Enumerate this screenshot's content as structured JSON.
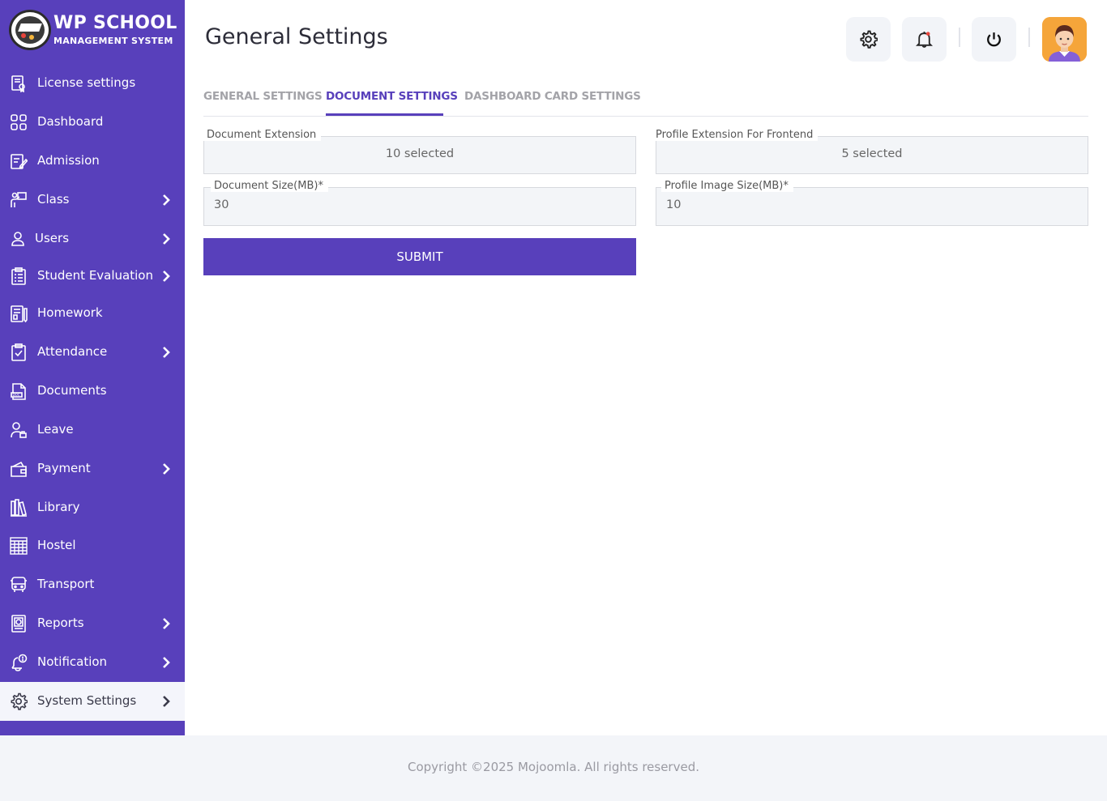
{
  "brand": {
    "title": "WP SCHOOL",
    "subtitle": "MANAGEMENT SYSTEM"
  },
  "sidebar": {
    "items": [
      {
        "label": "License settings",
        "icon": "license-icon",
        "has_submenu": false
      },
      {
        "label": "Dashboard",
        "icon": "dashboard-icon",
        "has_submenu": false
      },
      {
        "label": "Admission",
        "icon": "admission-icon",
        "has_submenu": false
      },
      {
        "label": "Class",
        "icon": "class-icon",
        "has_submenu": true
      },
      {
        "label": "Users",
        "icon": "user-icon",
        "has_submenu": true
      },
      {
        "label": "Student Evaluation",
        "icon": "evaluation-icon",
        "has_submenu": true
      },
      {
        "label": "Homework",
        "icon": "homework-icon",
        "has_submenu": false
      },
      {
        "label": "Attendance",
        "icon": "attendance-icon",
        "has_submenu": true
      },
      {
        "label": "Documents",
        "icon": "documents-icon",
        "has_submenu": false
      },
      {
        "label": "Leave",
        "icon": "leave-icon",
        "has_submenu": false
      },
      {
        "label": "Payment",
        "icon": "wallet-icon",
        "has_submenu": true
      },
      {
        "label": "Library",
        "icon": "library-icon",
        "has_submenu": false
      },
      {
        "label": "Hostel",
        "icon": "hostel-icon",
        "has_submenu": false
      },
      {
        "label": "Transport",
        "icon": "bus-icon",
        "has_submenu": false
      },
      {
        "label": "Reports",
        "icon": "reports-icon",
        "has_submenu": true
      },
      {
        "label": "Notification",
        "icon": "notification-icon",
        "has_submenu": true
      },
      {
        "label": "System Settings",
        "icon": "gear-icon",
        "has_submenu": true,
        "active": true
      }
    ]
  },
  "header": {
    "title": "General Settings"
  },
  "tabs": [
    {
      "label": "GENERAL SETTINGS",
      "active": false
    },
    {
      "label": "DOCUMENT SETTINGS",
      "active": true
    },
    {
      "label": "DASHBOARD CARD SETTINGS",
      "active": false
    }
  ],
  "form": {
    "document_extension": {
      "label": "Document Extension",
      "value": "10 selected"
    },
    "profile_extension": {
      "label": "Profile Extension For Frontend",
      "value": "5 selected"
    },
    "document_size": {
      "label": "Document Size(MB)*",
      "value": "30"
    },
    "profile_image_size": {
      "label": "Profile Image Size(MB)*",
      "value": "10"
    },
    "submit_label": "SUBMIT"
  },
  "footer": {
    "text": "Copyright ©2025 Mojoomla. All rights reserved."
  },
  "colors": {
    "primary": "#5840bb",
    "surface": "#f3f5f8",
    "avatar_bg": "#f5a53a"
  }
}
